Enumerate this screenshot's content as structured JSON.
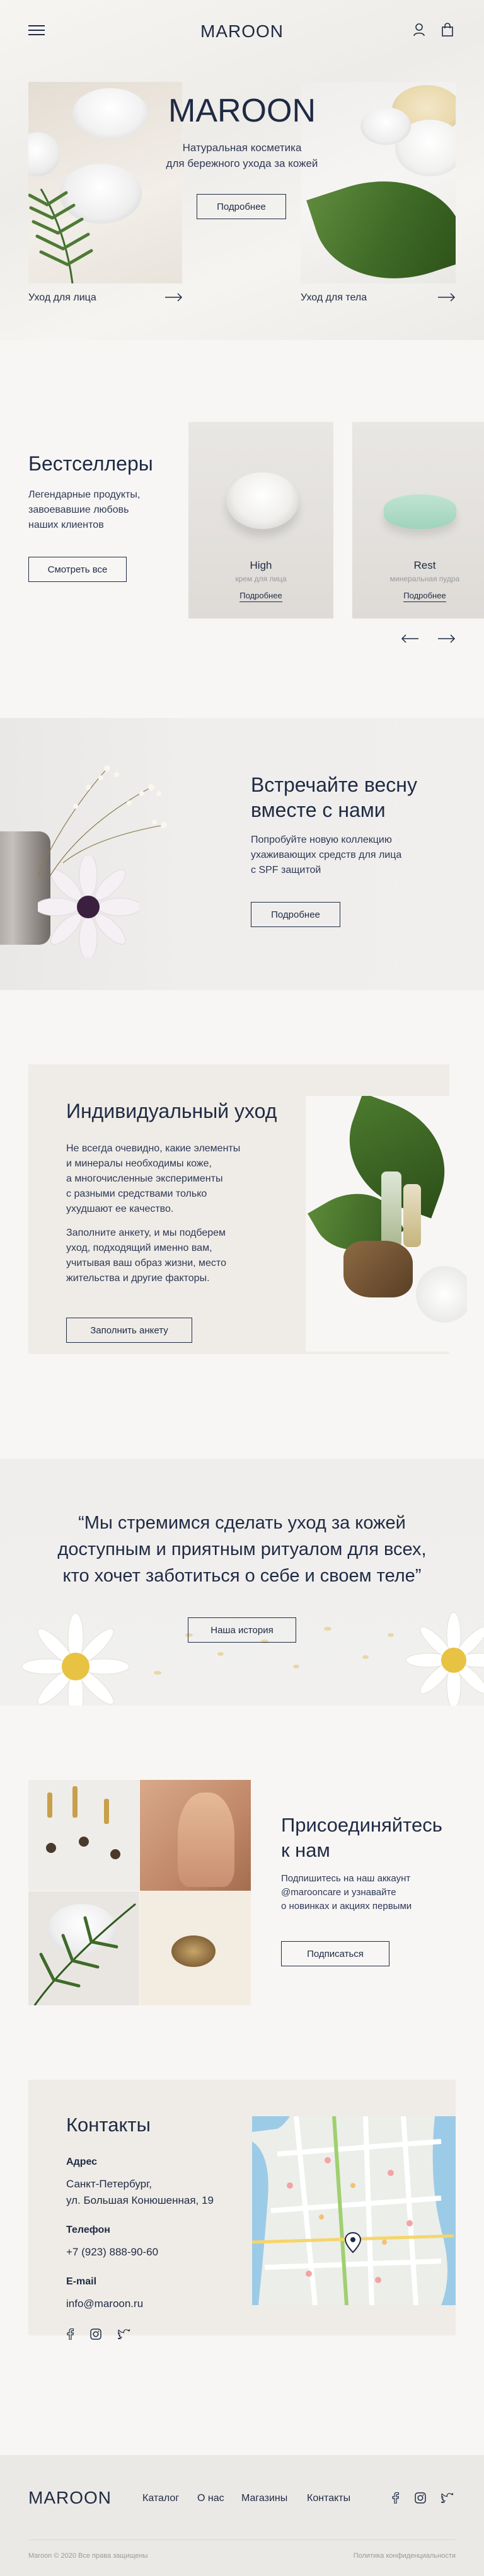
{
  "header": {
    "logo": "MAROON"
  },
  "hero": {
    "title": "MAROON",
    "subtitle_line1": "Натуральная косметика",
    "subtitle_line2": "для бережного ухода за кожей",
    "button": "Подробнее",
    "left_link": "Уход для лица",
    "right_link": "Уход для тела"
  },
  "bestsellers": {
    "title": "Бестселлеры",
    "description_line1": "Легендарные продукты,",
    "description_line2": "завоевавшие любовь",
    "description_line3": "наших клиентов",
    "button": "Смотреть все",
    "cards": [
      {
        "name": "High",
        "sub": "крем для лица",
        "link": "Подробнее"
      },
      {
        "name": "Rest",
        "sub": "минеральная пудра",
        "link": "Подробнее"
      }
    ]
  },
  "spring": {
    "title_line1": "Встречайте весну",
    "title_line2": "вместе с нами",
    "text_line1": "Попробуйте новую коллекцию",
    "text_line2": "ухаживающих средств для лица",
    "text_line3": "с SPF защитой",
    "button": "Подробнее"
  },
  "care": {
    "title": "Индивидуальный уход",
    "p1_line1": "Не всегда очевидно, какие элементы",
    "p1_line2": "и минералы необходимы коже,",
    "p1_line3": "а многочисленные эксперименты",
    "p1_line4": "с разными средствами только",
    "p1_line5": "ухудшают ее качество.",
    "p2_line1": "Заполните анкету, и мы подберем",
    "p2_line2": "уход, подходящий именно вам,",
    "p2_line3": "учитывая ваш образ жизни, место",
    "p2_line4": "жительства и другие факторы.",
    "button": "Заполнить анкету"
  },
  "quote": {
    "line1": "“Мы стремимся сделать уход за кожей",
    "line2": "доступным и приятным ритуалом для всех,",
    "line3": "кто хочет заботиться о себе и своем теле”",
    "button": "Наша история"
  },
  "join": {
    "title_line1": "Присоединяйтесь",
    "title_line2": "к нам",
    "text_line1": "Подпишитесь на наш аккаунт",
    "text_line2": "@marooncare и узнавайте",
    "text_line3": "о новинках и акциях первыми",
    "button": "Подписаться"
  },
  "contacts": {
    "title": "Контакты",
    "address_label": "Адрес",
    "address_line1": "Санкт-Петербург,",
    "address_line2": "ул. Большая Конюшенная, 19",
    "phone_label": "Телефон",
    "phone": "+7 (923) 888-90-60",
    "email_label": "E-mail",
    "email": "info@maroon.ru"
  },
  "footer": {
    "logo": "MAROON",
    "nav": [
      "Каталог",
      "О нас",
      "Магазины",
      "Контакты"
    ],
    "copyright": "Maroon © 2020 Все права защищены",
    "privacy": "Политика конфиденциальности"
  },
  "icons": {
    "menu": "hamburger-icon",
    "user": "user-icon",
    "cart": "bag-icon",
    "facebook": "facebook-icon",
    "instagram": "instagram-icon",
    "twitter": "twitter-icon"
  },
  "colors": {
    "navy": "#1f2a44",
    "background": "#f7f6f4",
    "beige": "#efece7",
    "muted": "#9a9a9a"
  }
}
